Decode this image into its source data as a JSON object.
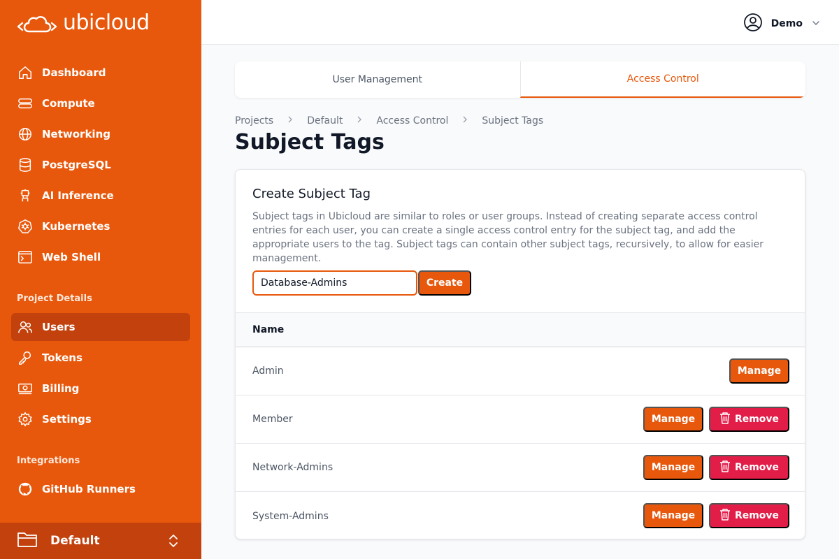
{
  "brand": {
    "name": "ubicloud",
    "accent": "#e8580c",
    "danger": "#e11d48"
  },
  "sidebar": {
    "main_items": [
      {
        "label": "Dashboard",
        "icon": "home-icon"
      },
      {
        "label": "Compute",
        "icon": "server-icon"
      },
      {
        "label": "Networking",
        "icon": "globe-icon"
      },
      {
        "label": "PostgreSQL",
        "icon": "database-icon"
      },
      {
        "label": "AI Inference",
        "icon": "robot-icon"
      },
      {
        "label": "Kubernetes",
        "icon": "kubernetes-icon"
      },
      {
        "label": "Web Shell",
        "icon": "terminal-icon"
      }
    ],
    "project_section_title": "Project Details",
    "project_items": [
      {
        "label": "Users",
        "icon": "users-icon",
        "active": true
      },
      {
        "label": "Tokens",
        "icon": "key-icon"
      },
      {
        "label": "Billing",
        "icon": "banknote-icon"
      },
      {
        "label": "Settings",
        "icon": "gear-icon"
      }
    ],
    "integrations_title": "Integrations",
    "integration_items": [
      {
        "label": "GitHub Runners",
        "icon": "github-icon"
      }
    ],
    "project_switcher": {
      "label": "Default",
      "icon": "folder-icon"
    }
  },
  "topbar": {
    "user_name": "Demo"
  },
  "tabs": [
    {
      "label": "User Management",
      "active": false
    },
    {
      "label": "Access Control",
      "active": true
    }
  ],
  "breadcrumb": [
    "Projects",
    "Default",
    "Access Control",
    "Subject Tags"
  ],
  "page_title": "Subject Tags",
  "create_card": {
    "title": "Create Subject Tag",
    "description": "Subject tags in Ubicloud are similar to roles or user groups. Instead of creating separate access control entries for each user, you can create a single access control entry for the subject tag, and add the appropriate users to the tag. Subject tags can contain other subject tags, recursively, to allow for easier management.",
    "input_value": "Database-Admins",
    "create_label": "Create"
  },
  "table": {
    "header": "Name",
    "manage_label": "Manage",
    "remove_label": "Remove",
    "rows": [
      {
        "name": "Admin",
        "removable": false
      },
      {
        "name": "Member",
        "removable": true
      },
      {
        "name": "Network-Admins",
        "removable": true
      },
      {
        "name": "System-Admins",
        "removable": true
      }
    ]
  }
}
